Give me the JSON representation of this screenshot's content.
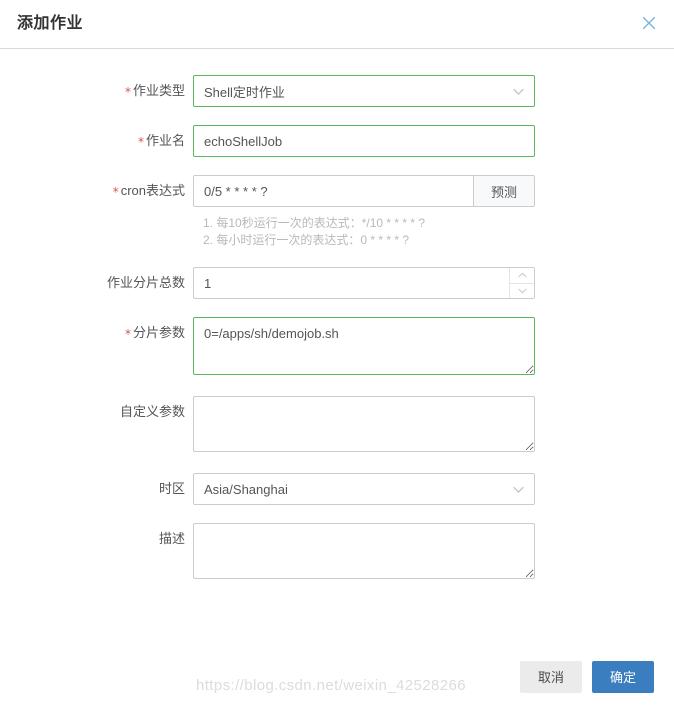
{
  "dialog": {
    "title": "添加作业",
    "close_icon": "close-icon"
  },
  "form": {
    "job_type": {
      "label": "作业类型",
      "required": true,
      "value": "Shell定时作业",
      "icon": "chevron-down-icon"
    },
    "job_name": {
      "label": "作业名",
      "required": true,
      "value": "echoShellJob",
      "placeholder": ""
    },
    "cron": {
      "label": "cron表达式",
      "required": true,
      "value": "0/5 * * * * ?",
      "placeholder": "",
      "addon_label": "预测",
      "hints": [
        "1. 每10秒运行一次的表达式：*/10 * * * * ?",
        "2. 每小时运行一次的表达式：0 * * * * ?"
      ]
    },
    "shard_total": {
      "label": "作业分片总数",
      "required": false,
      "value": "1",
      "up_icon": "chevron-up-icon",
      "down_icon": "chevron-down-icon"
    },
    "shard_params": {
      "label": "分片参数",
      "required": true,
      "value": "0=/apps/sh/demojob.sh",
      "placeholder": ""
    },
    "custom_params": {
      "label": "自定义参数",
      "required": false,
      "value": "",
      "placeholder": ""
    },
    "timezone": {
      "label": "时区",
      "required": false,
      "value": "Asia/Shanghai",
      "icon": "chevron-down-icon"
    },
    "description": {
      "label": "描述",
      "required": false,
      "value": "",
      "placeholder": ""
    }
  },
  "footer": {
    "cancel_label": "取消",
    "confirm_label": "确定"
  },
  "watermark": {
    "text": "https://blog.csdn.net/weixin_42528266"
  },
  "colors": {
    "valid_border": "#5cb85c",
    "required_star": "#d9534f",
    "primary_button": "#3a7ebf",
    "default_button": "#ebebeb",
    "close_icon": "#78b4e0"
  }
}
